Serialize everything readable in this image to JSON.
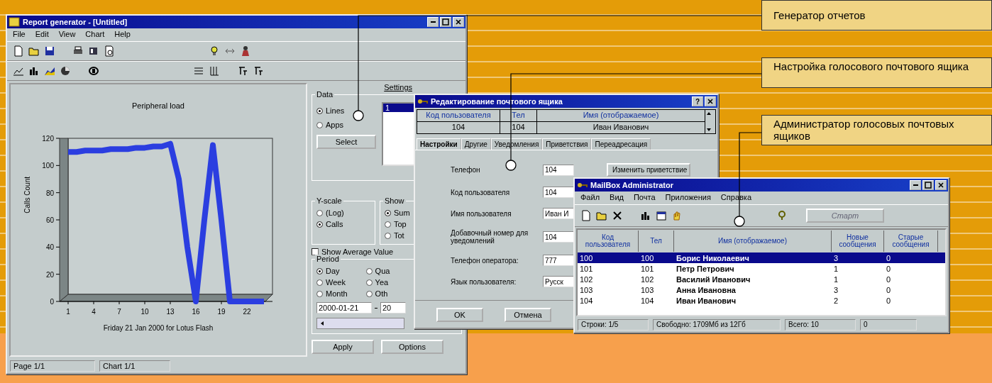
{
  "report_window": {
    "title": "Report generator - [Untitled]",
    "menu": [
      "File",
      "Edit",
      "View",
      "Chart",
      "Help"
    ],
    "chart": {
      "title": "Peripheral load",
      "chart_data": {
        "type": "line",
        "xlabel": "Friday 21 Jan 2000 for Lotus Flash",
        "ylabel": "Calls Count",
        "x": [
          1,
          2,
          3,
          4,
          5,
          6,
          7,
          8,
          9,
          10,
          11,
          12,
          13,
          14,
          15,
          16,
          17,
          18,
          19,
          20,
          21,
          22,
          23,
          24
        ],
        "series": [
          {
            "color": "#2b3ee0",
            "values": [
              110,
              110,
              111,
              111,
              111,
              112,
              112,
              112,
              113,
              113,
              114,
              114,
              116,
              90,
              40,
              0,
              60,
              115,
              60,
              0,
              0,
              0,
              0,
              0
            ]
          }
        ],
        "xlim": [
          0,
          25
        ],
        "ylim": [
          0,
          120
        ],
        "yticks": [
          0,
          20,
          40,
          60,
          80,
          100,
          120
        ],
        "xticks": [
          1,
          4,
          7,
          10,
          13,
          16,
          19,
          22
        ]
      }
    },
    "settings_link": "Settings",
    "data_group": {
      "label": "Data",
      "options": [
        {
          "label": "Lines",
          "selected": true
        },
        {
          "label": "Apps",
          "selected": false
        }
      ],
      "list": [
        {
          "label": "1",
          "selected": true
        }
      ],
      "button": "Select"
    },
    "y_scale_group": {
      "label": "Y-scale",
      "options": [
        {
          "label": "(Log)",
          "selected": false
        },
        {
          "label": "Calls",
          "selected": true
        }
      ]
    },
    "show_group": {
      "label": "Show",
      "options": [
        {
          "label": "Sum",
          "selected": true
        },
        {
          "label": "Top",
          "selected": false
        },
        {
          "label": "Tot",
          "selected": false
        }
      ]
    },
    "show_average": {
      "label": "Show Average Value",
      "checked": false
    },
    "period_group": {
      "label": "Period",
      "options": [
        {
          "label": "Day",
          "selected": true
        },
        {
          "label": "Week",
          "selected": false
        },
        {
          "label": "Month",
          "selected": false
        },
        {
          "label": "Qua",
          "selected": false
        },
        {
          "label": "Yea",
          "selected": false
        },
        {
          "label": "Oth",
          "selected": false
        }
      ]
    },
    "date_from": "2000-01-21",
    "date_to": "20",
    "buttons": [
      "Apply",
      "Options"
    ],
    "status_bar": [
      "Page 1/1",
      "Chart 1/1"
    ]
  },
  "mailbox_editor": {
    "title": "Редактирование почтового ящика",
    "help_button": "?",
    "columns": [
      "Код пользователя",
      "Тел",
      "Имя (отображаемое)"
    ],
    "row": [
      "104",
      "104",
      "Иван Иванович"
    ],
    "tabs": [
      {
        "label": "Настройки",
        "selected": true
      },
      {
        "label": "Другие",
        "selected": false
      },
      {
        "label": "Уведомления",
        "selected": false
      },
      {
        "label": "Приветствия",
        "selected": false
      },
      {
        "label": "Переадресация",
        "selected": false
      }
    ],
    "fields": [
      {
        "label": "Телефон",
        "value": "104"
      },
      {
        "label": "Код пользователя",
        "value": "104"
      },
      {
        "label": "Имя пользователя",
        "value": "Иван И"
      },
      {
        "label": "Добавочный номер для уведомлений",
        "value": "104"
      },
      {
        "label": "Телефон оператора:",
        "value": "777"
      },
      {
        "label": "Язык пользователя:",
        "value": "Русск"
      }
    ],
    "greeting_button": "Изменить приветствие",
    "buttons": [
      "OK",
      "Отмена"
    ]
  },
  "mailbox_admin": {
    "title": "MailBox Administrator",
    "menu": [
      "Файл",
      "Вид",
      "Почта",
      "Приложения",
      "Справка"
    ],
    "start_button": "Старт",
    "columns": [
      "Код пользователя",
      "Тел",
      "Имя (отображаемое)",
      "Новые сообщения",
      "Старые сообщения"
    ],
    "rows": [
      {
        "cells": [
          "100",
          "100",
          "Борис Николаевич",
          "3",
          "0"
        ],
        "selected": true
      },
      {
        "cells": [
          "101",
          "101",
          "Петр Петрович",
          "1",
          "0"
        ],
        "selected": false
      },
      {
        "cells": [
          "102",
          "102",
          "Василий Иванович",
          "1",
          "0"
        ],
        "selected": false
      },
      {
        "cells": [
          "103",
          "103",
          "Анна Ивановна",
          "3",
          "0"
        ],
        "selected": false
      },
      {
        "cells": [
          "104",
          "104",
          "Иван Иванович",
          "2",
          "0"
        ],
        "selected": false
      }
    ],
    "status_bar": [
      "Строки: 1/5",
      "Свободно: 1709Мб из 12Гб",
      "Всего: 10",
      "0"
    ]
  },
  "callouts": [
    {
      "text": "Генератор отчетов"
    },
    {
      "text": "Настройка голосового почтового ящика"
    },
    {
      "text": "Администратор голосовых почтовых ящиков"
    }
  ]
}
